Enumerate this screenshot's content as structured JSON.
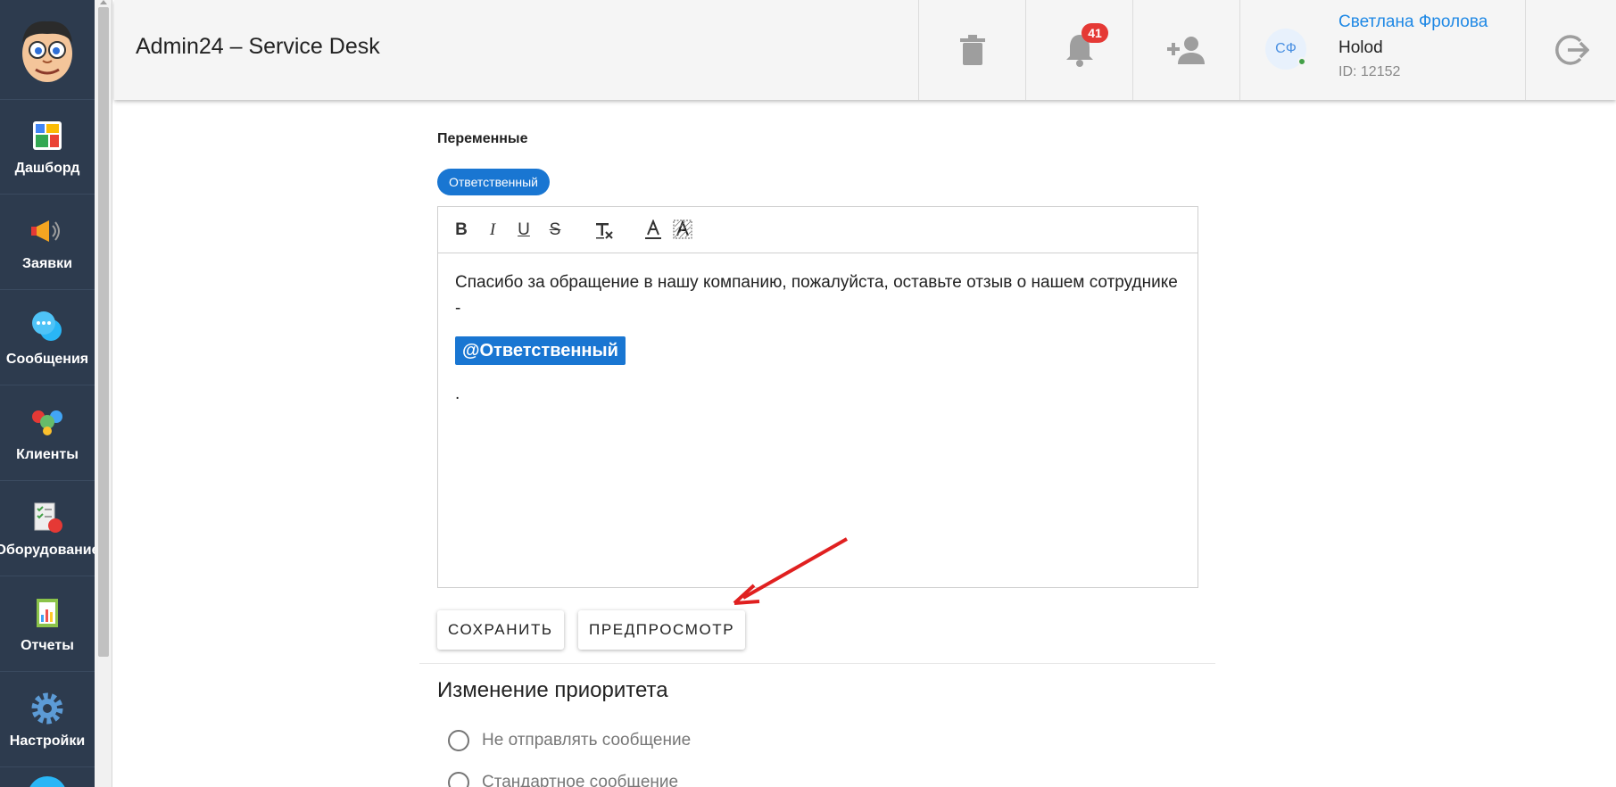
{
  "sidebar": {
    "items": [
      {
        "label": "Дашборд",
        "icon": "dashboard-icon"
      },
      {
        "label": "Заявки",
        "icon": "megaphone-icon"
      },
      {
        "label": "Сообщения",
        "icon": "chat-bubbles-icon"
      },
      {
        "label": "Клиенты",
        "icon": "clients-icon"
      },
      {
        "label": "Оборудование",
        "icon": "equipment-icon"
      },
      {
        "label": "Отчеты",
        "icon": "reports-icon"
      },
      {
        "label": "Настройки",
        "icon": "gear-icon"
      }
    ]
  },
  "header": {
    "title": "Admin24 – Service Desk",
    "notifications_count": "41",
    "user": {
      "initials": "СФ",
      "name": "Светлана Фролова",
      "org": "Holod",
      "id": "ID: 12152"
    }
  },
  "editor": {
    "variables_label": "Переменные",
    "variable_chip": "Ответственный",
    "text": "Спасибо за обращение в нашу компанию, пожалуйста, оставьте отзыв о нашем сотруднике -",
    "mention": "@Ответственный",
    "trailing": "."
  },
  "actions": {
    "save": "СОХРАНИТЬ",
    "preview": "ПРЕДПРОСМОТР"
  },
  "priority": {
    "title": "Изменение приоритета",
    "options": [
      "Не отправлять сообщение",
      "Стандартное сообщение"
    ]
  },
  "colors": {
    "sidebar": "#2d3b4e",
    "accent": "#1976d2",
    "badge": "#e53935",
    "annotation_arrow": "#e02020"
  }
}
